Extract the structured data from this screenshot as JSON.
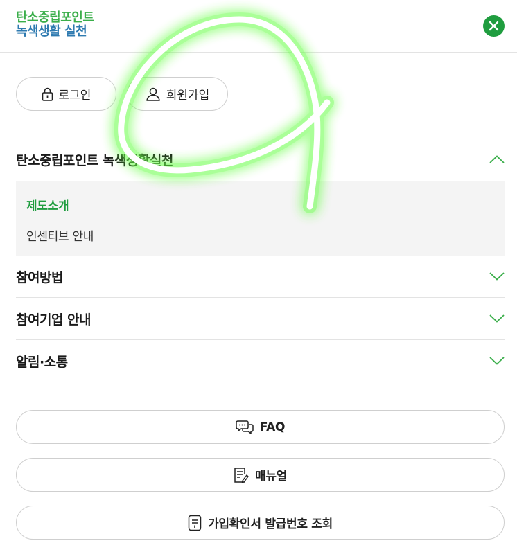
{
  "header": {
    "logo_line1": "탄소중립포인트",
    "logo_line2": "녹색생활 실천",
    "close_icon": "close-icon"
  },
  "auth": {
    "login_label": "로그인",
    "signup_label": "회원가입"
  },
  "menu": [
    {
      "label": "탄소중립포인트 녹색생활실천",
      "expanded": true,
      "children": [
        {
          "label": "제도소개",
          "active": true
        },
        {
          "label": "인센티브 안내",
          "active": false
        }
      ]
    },
    {
      "label": "참여방법",
      "expanded": false
    },
    {
      "label": "참여기업 안내",
      "expanded": false
    },
    {
      "label": "알림·소통",
      "expanded": false
    }
  ],
  "links": {
    "faq_label": "FAQ",
    "manual_label": "매뉴얼",
    "certificate_label": "가입확인서 발급번호 조회"
  },
  "colors": {
    "brand_green": "#1f9d3f",
    "logo_blue": "#2e7ab0",
    "logo_green": "#3aae4a",
    "chevron_green": "#3aae4a",
    "submenu_bg": "#f4f4f4"
  }
}
